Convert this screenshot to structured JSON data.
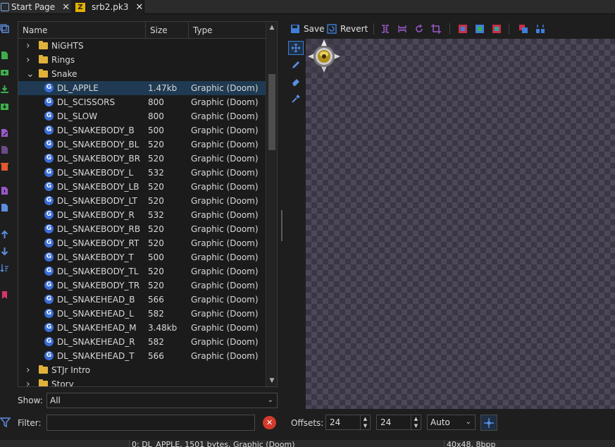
{
  "tabs": [
    {
      "label": "Start Page",
      "icon": "start-page-icon",
      "active": false
    },
    {
      "label": "srb2.pk3",
      "icon": "pk3-archive-icon",
      "active": true
    }
  ],
  "tree": {
    "columns": [
      "Name",
      "Size",
      "Type"
    ],
    "folders_top": [
      {
        "name": "NiGHTS",
        "expanded": false
      },
      {
        "name": "Rings",
        "expanded": false
      },
      {
        "name": "Snake",
        "expanded": true
      }
    ],
    "entries": [
      {
        "name": "DL_APPLE",
        "size": "1.47kb",
        "type": "Graphic (Doom)",
        "selected": true
      },
      {
        "name": "DL_SCISSORS",
        "size": "800",
        "type": "Graphic (Doom)"
      },
      {
        "name": "DL_SLOW",
        "size": "800",
        "type": "Graphic (Doom)"
      },
      {
        "name": "DL_SNAKEBODY_B",
        "size": "500",
        "type": "Graphic (Doom)"
      },
      {
        "name": "DL_SNAKEBODY_BL",
        "size": "520",
        "type": "Graphic (Doom)"
      },
      {
        "name": "DL_SNAKEBODY_BR",
        "size": "520",
        "type": "Graphic (Doom)"
      },
      {
        "name": "DL_SNAKEBODY_L",
        "size": "532",
        "type": "Graphic (Doom)"
      },
      {
        "name": "DL_SNAKEBODY_LB",
        "size": "520",
        "type": "Graphic (Doom)"
      },
      {
        "name": "DL_SNAKEBODY_LT",
        "size": "520",
        "type": "Graphic (Doom)"
      },
      {
        "name": "DL_SNAKEBODY_R",
        "size": "532",
        "type": "Graphic (Doom)"
      },
      {
        "name": "DL_SNAKEBODY_RB",
        "size": "520",
        "type": "Graphic (Doom)"
      },
      {
        "name": "DL_SNAKEBODY_RT",
        "size": "520",
        "type": "Graphic (Doom)"
      },
      {
        "name": "DL_SNAKEBODY_T",
        "size": "500",
        "type": "Graphic (Doom)"
      },
      {
        "name": "DL_SNAKEBODY_TL",
        "size": "520",
        "type": "Graphic (Doom)"
      },
      {
        "name": "DL_SNAKEBODY_TR",
        "size": "520",
        "type": "Graphic (Doom)"
      },
      {
        "name": "DL_SNAKEHEAD_B",
        "size": "566",
        "type": "Graphic (Doom)"
      },
      {
        "name": "DL_SNAKEHEAD_L",
        "size": "582",
        "type": "Graphic (Doom)"
      },
      {
        "name": "DL_SNAKEHEAD_M",
        "size": "3.48kb",
        "type": "Graphic (Doom)"
      },
      {
        "name": "DL_SNAKEHEAD_R",
        "size": "582",
        "type": "Graphic (Doom)"
      },
      {
        "name": "DL_SNAKEHEAD_T",
        "size": "566",
        "type": "Graphic (Doom)"
      }
    ],
    "folders_bottom": [
      {
        "name": "STJr Intro",
        "expanded": false
      },
      {
        "name": "Story",
        "expanded": false
      }
    ]
  },
  "show": {
    "label": "Show:",
    "value": "All"
  },
  "filter": {
    "label": "Filter:",
    "value": "",
    "placeholder": ""
  },
  "editor_toolbar": {
    "save_label": "Save",
    "revert_label": "Revert"
  },
  "offsets": {
    "label": "Offsets:",
    "x": "24",
    "y": "24",
    "mode": "Auto"
  },
  "status": {
    "left": "",
    "middle": "0: DL_APPLE, 1501 bytes, Graphic (Doom)",
    "right": "40x48, 8bpp"
  },
  "colors": {
    "accent": "#3d7fd8",
    "selection": "#1f3a52",
    "folder": "#e0b23c"
  }
}
